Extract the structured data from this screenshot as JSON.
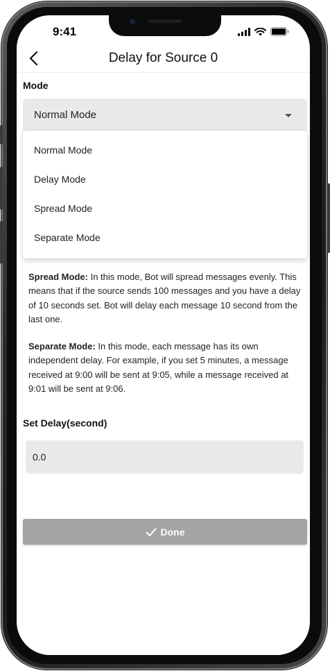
{
  "status": {
    "time": "9:41"
  },
  "header": {
    "title": "Delay for Source 0"
  },
  "mode": {
    "label": "Mode",
    "selected": "Normal Mode",
    "options": [
      "Normal Mode",
      "Delay Mode",
      "Spread Mode",
      "Separate Mode"
    ]
  },
  "descriptions": {
    "spread": {
      "term": "Spread Mode:",
      "text": " In this mode, Bot will spread messages evenly. This means that if the source sends 100 messages and you have a delay of 10 seconds set. Bot will delay each message 10 second from the last one."
    },
    "separate": {
      "term": "Separate Mode:",
      "text": " In this mode, each message has its own independent delay. For example, if you set 5 minutes, a message received at 9:00 will be sent at 9:05, while a message received at 9:01 will be sent at 9:06."
    }
  },
  "delay": {
    "label": "Set Delay(second)",
    "value": "0.0"
  },
  "done": {
    "label": "Done"
  },
  "colors": {
    "field_bg": "#e9e9e9",
    "button_bg": "#a4a4a4"
  }
}
